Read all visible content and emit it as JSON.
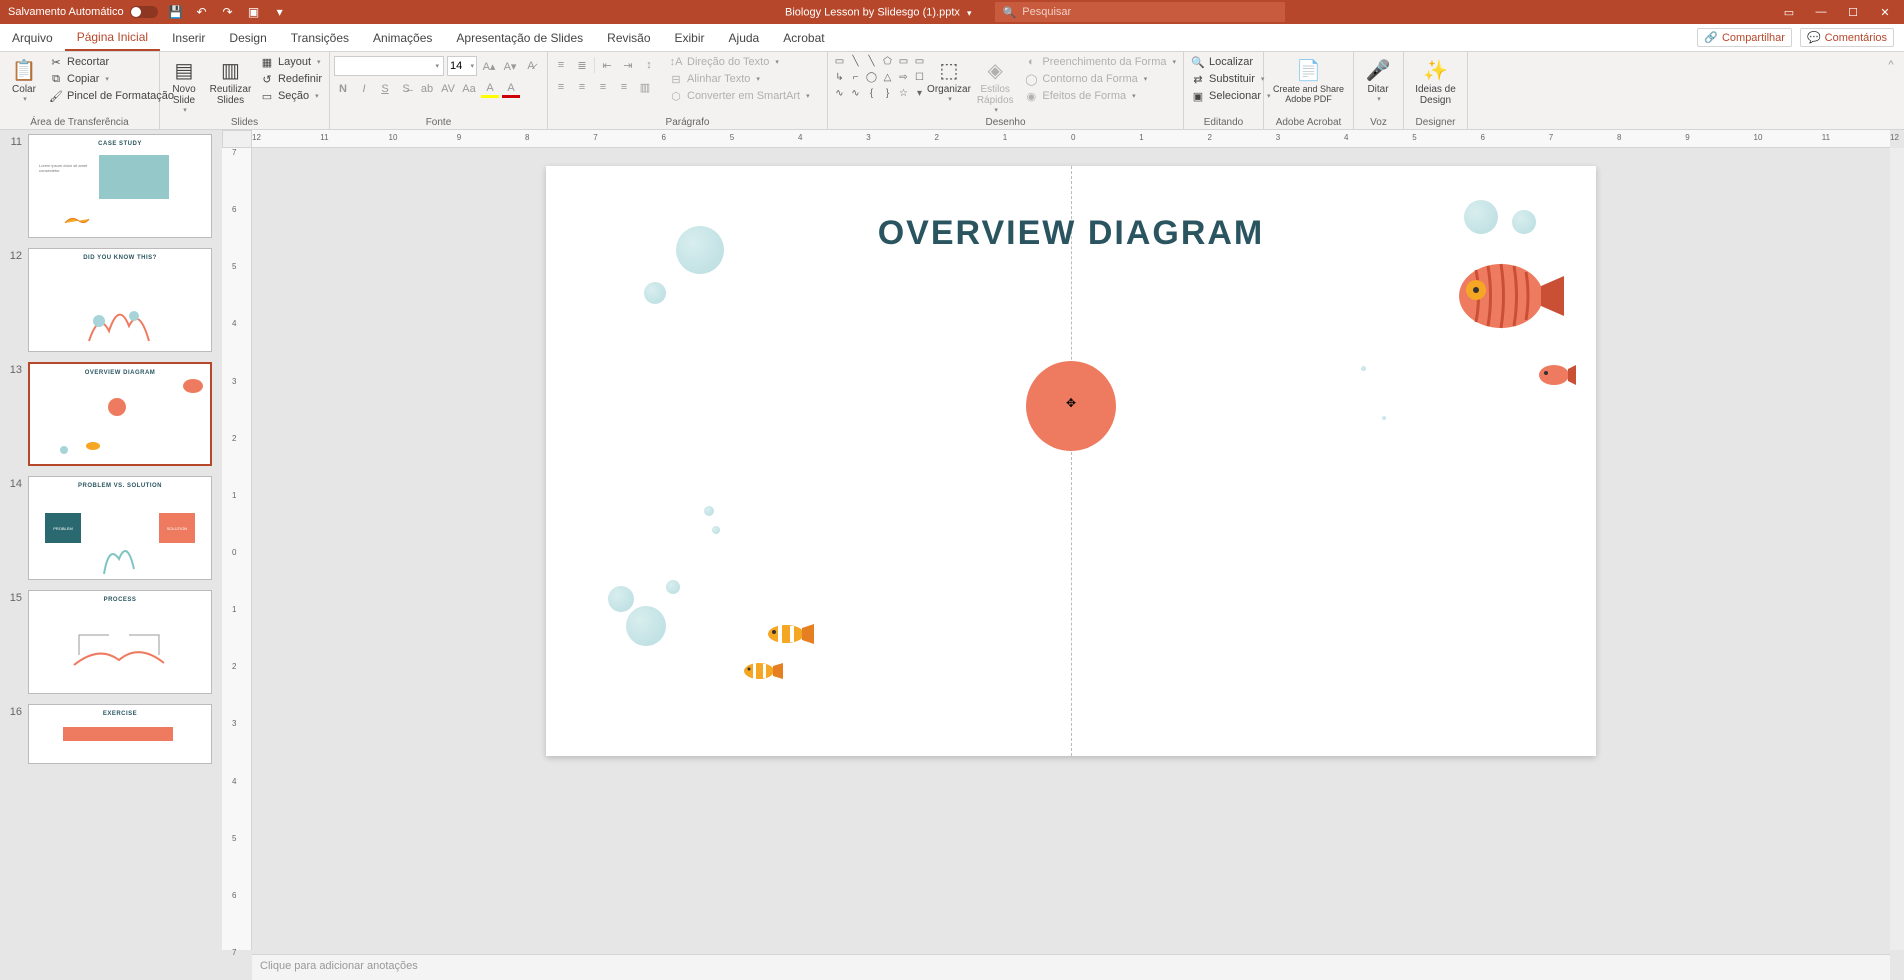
{
  "titlebar": {
    "autosave_label": "Salvamento Automático",
    "filename": "Biology Lesson by Slidesgo (1).pptx",
    "search_placeholder": "Pesquisar"
  },
  "tabs": {
    "items": [
      "Arquivo",
      "Página Inicial",
      "Inserir",
      "Design",
      "Transições",
      "Animações",
      "Apresentação de Slides",
      "Revisão",
      "Exibir",
      "Ajuda",
      "Acrobat"
    ],
    "active_index": 1,
    "share_label": "Compartilhar",
    "comments_label": "Comentários"
  },
  "ribbon": {
    "clipboard": {
      "group_label": "Área de Transferência",
      "paste": "Colar",
      "cut": "Recortar",
      "copy": "Copiar",
      "format_painter": "Pincel de Formatação"
    },
    "slides": {
      "group_label": "Slides",
      "new_slide": "Novo Slide",
      "reuse_slides": "Reutilizar Slides",
      "layout": "Layout",
      "reset": "Redefinir",
      "section": "Seção"
    },
    "font": {
      "group_label": "Fonte",
      "font_name": "",
      "font_size": "14"
    },
    "paragraph": {
      "group_label": "Parágrafo",
      "text_direction": "Direção do Texto",
      "align_text": "Alinhar Texto",
      "convert_smartart": "Converter em SmartArt"
    },
    "drawing": {
      "group_label": "Desenho",
      "arrange": "Organizar",
      "quick_styles": "Estilos Rápidos",
      "shape_fill": "Preenchimento da Forma",
      "shape_outline": "Contorno da Forma",
      "shape_effects": "Efeitos de Forma"
    },
    "editing": {
      "group_label": "Editando",
      "find": "Localizar",
      "replace": "Substituir",
      "select": "Selecionar"
    },
    "adobe_group": {
      "group_label": "Adobe Acrobat",
      "create_share": "Create and Share Adobe PDF"
    },
    "voice": {
      "group_label": "Voz",
      "dictate": "Ditar"
    },
    "designer": {
      "group_label": "Designer",
      "ideas": "Ideias de Design"
    }
  },
  "thumbnails": [
    {
      "num": "11",
      "title": "CASE STUDY"
    },
    {
      "num": "12",
      "title": "DID YOU KNOW THIS?"
    },
    {
      "num": "13",
      "title": "OVERVIEW DIAGRAM",
      "selected": true
    },
    {
      "num": "14",
      "title": "PROBLEM VS. SOLUTION"
    },
    {
      "num": "15",
      "title": "PROCESS"
    },
    {
      "num": "16",
      "title": "EXERCISE"
    }
  ],
  "slide": {
    "title": "OVERVIEW DIAGRAM"
  },
  "notes_placeholder": "Clique para adicionar anotações",
  "ruler": {
    "h_ticks": [
      "12",
      "11",
      "10",
      "9",
      "8",
      "7",
      "6",
      "5",
      "4",
      "3",
      "2",
      "1",
      "0",
      "1",
      "2",
      "3",
      "4",
      "5",
      "6",
      "7",
      "8",
      "9",
      "10",
      "11",
      "12"
    ],
    "v_ticks": [
      "7",
      "6",
      "5",
      "4",
      "3",
      "2",
      "1",
      "0",
      "1",
      "2",
      "3",
      "4",
      "5",
      "6",
      "7"
    ]
  }
}
